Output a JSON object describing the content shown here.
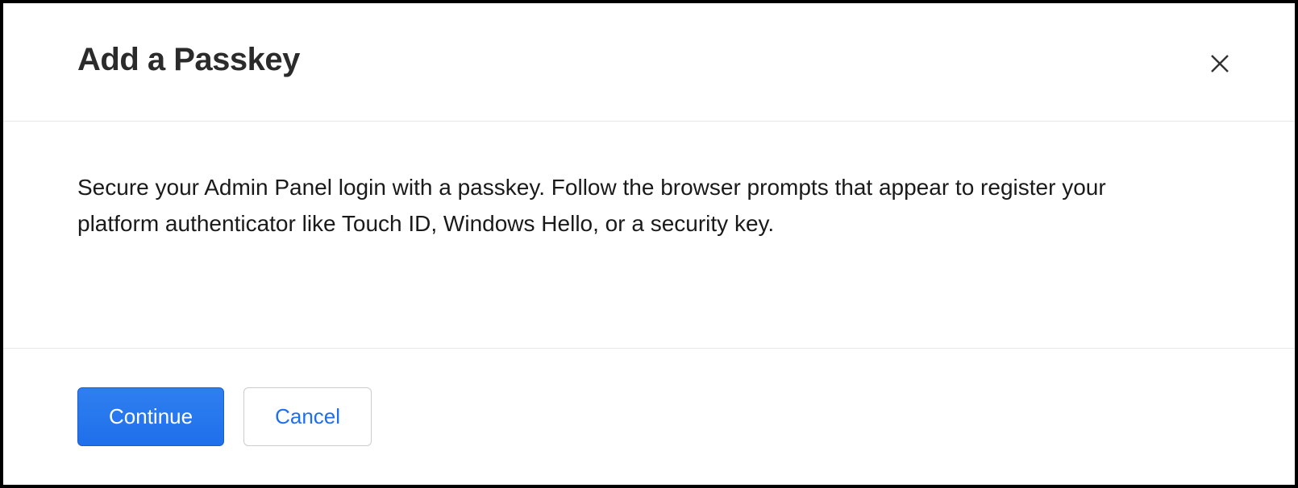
{
  "dialog": {
    "title": "Add a Passkey",
    "description": "Secure your Admin Panel login with a passkey. Follow the browser prompts that appear to register your platform authenticator like Touch ID, Windows Hello, or a security key.",
    "buttons": {
      "continue": "Continue",
      "cancel": "Cancel"
    }
  }
}
